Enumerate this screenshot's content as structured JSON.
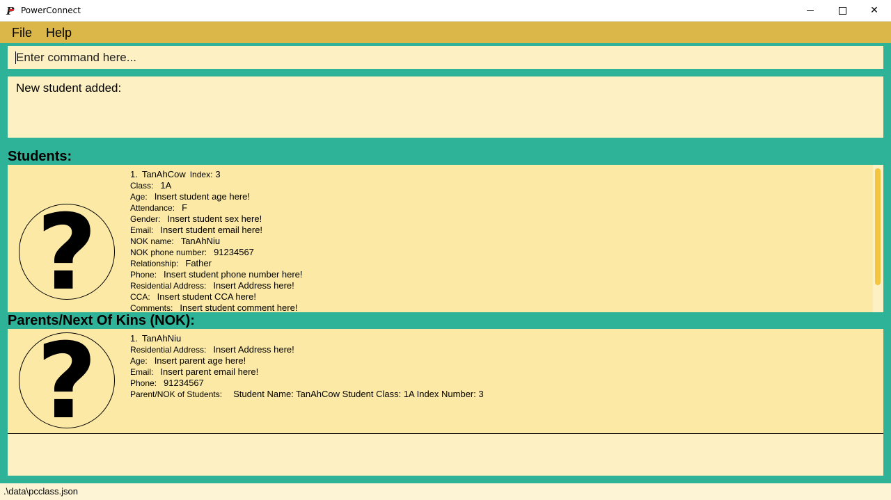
{
  "window": {
    "title": "PowerConnect",
    "app_icon_letter": "P",
    "controls": {
      "minimize": "minimize-icon",
      "maximize": "maximize-icon",
      "close": "✕"
    }
  },
  "menu": {
    "file": "File",
    "help": "Help"
  },
  "command": {
    "placeholder": "Enter command here...",
    "value": ""
  },
  "result": {
    "text": "New student added:"
  },
  "students_header": "Students:",
  "parents_header": "Parents/Next Of Kins (NOK):",
  "students": [
    {
      "number": "1.",
      "name": "TanAhCow",
      "index_label": "Index:",
      "index_value": "3",
      "fields": [
        {
          "label": "Class:",
          "value": "1A"
        },
        {
          "label": "Age:",
          "value": "Insert student age here!"
        },
        {
          "label": "Attendance:",
          "value": "F"
        },
        {
          "label": "Gender:",
          "value": "Insert student sex here!"
        },
        {
          "label": "Email:",
          "value": "Insert student email here!"
        },
        {
          "label": "NOK name:",
          "value": "TanAhNiu"
        },
        {
          "label": "NOK phone number:",
          "value": "91234567"
        },
        {
          "label": "Relationship:",
          "value": "Father"
        },
        {
          "label": "Phone:",
          "value": "Insert student phone number here!"
        },
        {
          "label": "Residential Address:",
          "value": "Insert Address here!"
        },
        {
          "label": "CCA:",
          "value": "Insert student CCA here!"
        },
        {
          "label": "Comments:",
          "value": "Insert student comment here!"
        }
      ]
    }
  ],
  "parents": [
    {
      "number": "1.",
      "name": "TanAhNiu",
      "fields": [
        {
          "label": "Residential Address:",
          "value": "Insert Address here!"
        },
        {
          "label": "Age:",
          "value": "Insert parent age here!"
        },
        {
          "label": "Email:",
          "value": "Insert parent email here!"
        },
        {
          "label": "Phone:",
          "value": "91234567"
        },
        {
          "label": "Parent/NOK of Students:",
          "value": "Student Name: TanAhCow Student Class: 1A Index Number: 3"
        }
      ]
    }
  ],
  "status": {
    "file_path": ".\\data\\pcclass.json"
  },
  "colors": {
    "background": "#2eb398",
    "menubar": "#dbb749",
    "card": "#fbe9a5",
    "input": "#fdf0c2",
    "scrollbar": "#f4c53e"
  }
}
